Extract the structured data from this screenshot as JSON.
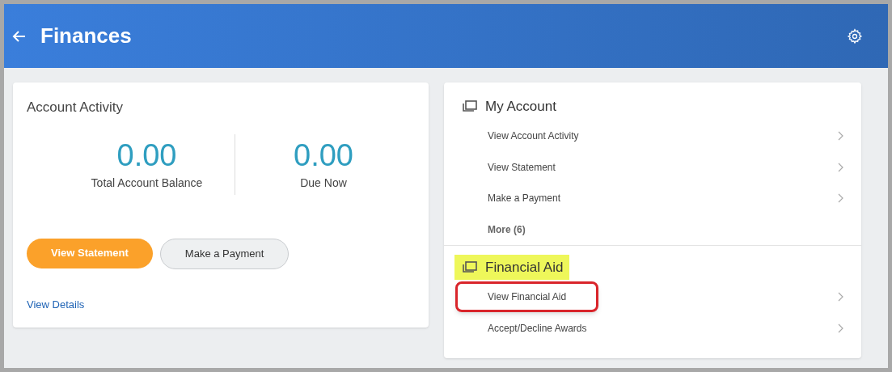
{
  "header": {
    "title": "Finances"
  },
  "account_activity": {
    "title": "Account Activity",
    "metrics": [
      {
        "value": "0.00",
        "label": "Total Account Balance"
      },
      {
        "value": "0.00",
        "label": "Due Now"
      }
    ],
    "buttons": [
      {
        "label": "View Statement",
        "kind": "primary"
      },
      {
        "label": "Make a Payment",
        "kind": "secondary"
      }
    ],
    "link": "View Details"
  },
  "sections": [
    {
      "title": "My Account",
      "highlighted": false,
      "items": [
        {
          "label": "View Account Activity",
          "kind": "link",
          "outlined": false
        },
        {
          "label": "View Statement",
          "kind": "link",
          "outlined": false
        },
        {
          "label": "Make a Payment",
          "kind": "link",
          "outlined": false
        },
        {
          "label": "More (6)",
          "kind": "more",
          "outlined": false
        }
      ]
    },
    {
      "title": "Financial Aid",
      "highlighted": true,
      "items": [
        {
          "label": "View Financial Aid",
          "kind": "link",
          "outlined": true
        },
        {
          "label": "Accept/Decline Awards",
          "kind": "link",
          "outlined": false
        }
      ]
    }
  ]
}
